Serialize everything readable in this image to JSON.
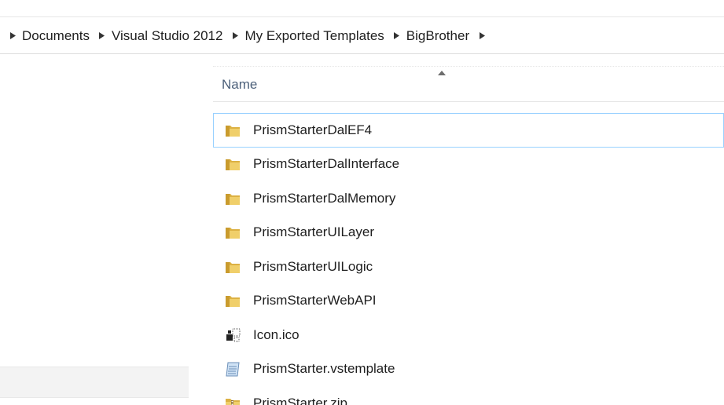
{
  "breadcrumb": [
    {
      "label": "Documents"
    },
    {
      "label": "Visual Studio 2012"
    },
    {
      "label": "My Exported Templates"
    },
    {
      "label": "BigBrother"
    }
  ],
  "column_header": {
    "name_label": "Name",
    "sort": "ascending"
  },
  "files": [
    {
      "name": "PrismStarterDalEF4",
      "icon": "folder-icon",
      "selected": true
    },
    {
      "name": "PrismStarterDalInterface",
      "icon": "folder-icon"
    },
    {
      "name": "PrismStarterDalMemory",
      "icon": "folder-icon"
    },
    {
      "name": "PrismStarterUILayer",
      "icon": "folder-icon"
    },
    {
      "name": "PrismStarterUILogic",
      "icon": "folder-icon"
    },
    {
      "name": "PrismStarterWebAPI",
      "icon": "folder-icon"
    },
    {
      "name": "Icon.ico",
      "icon": "ico-file-icon"
    },
    {
      "name": "PrismStarter.vstemplate",
      "icon": "notepad-file-icon"
    },
    {
      "name": "PrismStarter.zip",
      "icon": "zip-folder-icon"
    }
  ],
  "colors": {
    "header_text": "#4c607a",
    "selection_border": "#99d1ff",
    "folder": "#e8c25a"
  }
}
